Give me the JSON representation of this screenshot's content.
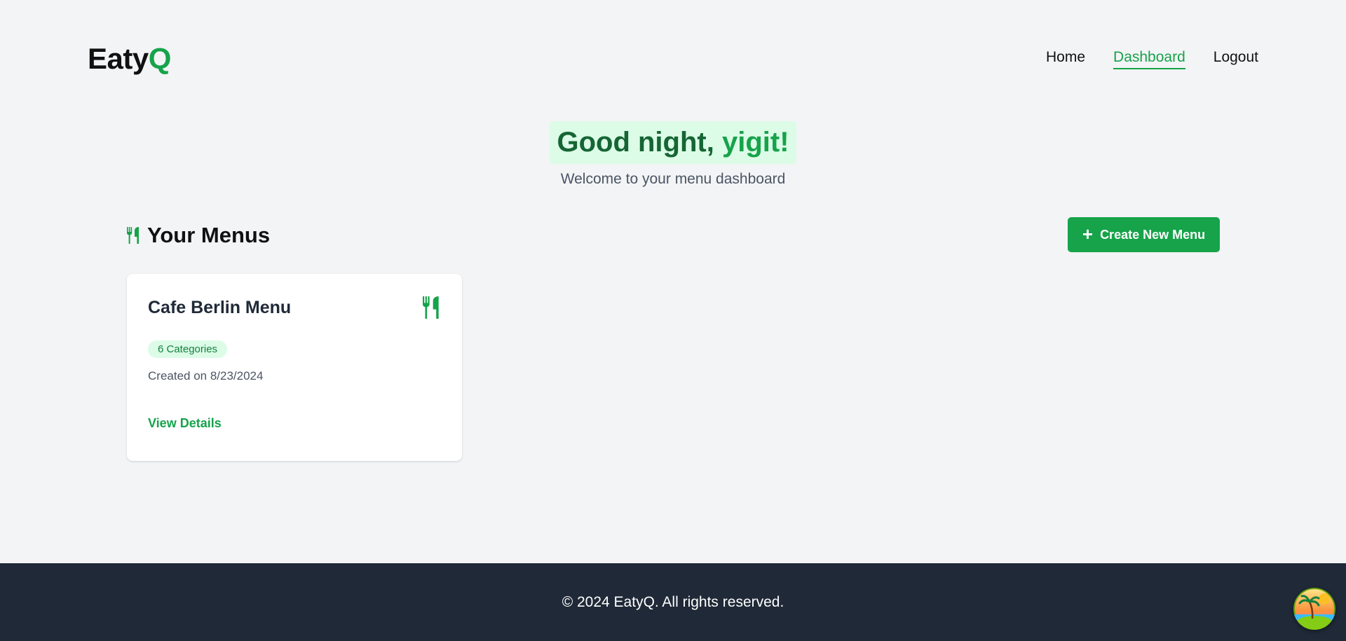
{
  "header": {
    "logo_main": "Eaty",
    "logo_accent": "Q",
    "nav": {
      "home": "Home",
      "dashboard": "Dashboard",
      "logout": "Logout"
    }
  },
  "greeting": {
    "prefix": "Good night, ",
    "name": "yigit!",
    "subtitle": "Welcome to your menu dashboard"
  },
  "menus_section": {
    "title": "Your Menus",
    "icon": "utensils-icon",
    "create_button_label": "Create New Menu"
  },
  "menus": [
    {
      "title": "Cafe Berlin Menu",
      "icon": "utensils-icon",
      "categories_badge": "6 Categories",
      "created": "Created on 8/23/2024",
      "link": "View Details"
    }
  ],
  "footer": {
    "copyright": "© 2024 EatyQ. All rights reserved."
  },
  "colors": {
    "accent": "#16a34a",
    "accent_dark": "#166534",
    "badge_bg": "#dcfce7",
    "footer_bg": "#1f2937",
    "page_bg": "#f3f4f6"
  }
}
